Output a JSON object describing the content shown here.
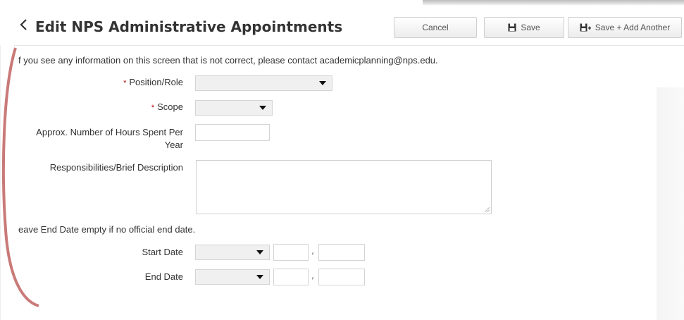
{
  "header": {
    "title": "Edit NPS Administrative Appointments",
    "buttons": {
      "cancel": "Cancel",
      "save": "Save",
      "save_add": "Save + Add Another"
    }
  },
  "notice": "f you see any information on this screen that is not correct, please contact academicplanning@nps.edu.",
  "fields": {
    "position_role": {
      "label": "Position/Role",
      "required": true,
      "value": ""
    },
    "scope": {
      "label": "Scope",
      "required": true,
      "value": ""
    },
    "hours_line1": "Approx. Number of Hours Spent Per",
    "hours_line2": "Year",
    "responsibilities": "Responsibilities/Brief Description",
    "required_marker": "*"
  },
  "end_date_note": "eave End Date empty if no official end date.",
  "dates": {
    "start_label": "Start Date",
    "end_label": "End Date",
    "separator": ","
  },
  "icons": {
    "back": "chevron-left-icon",
    "save": "floppy-disk-icon",
    "save_add": "floppy-disk-plus-icon"
  }
}
